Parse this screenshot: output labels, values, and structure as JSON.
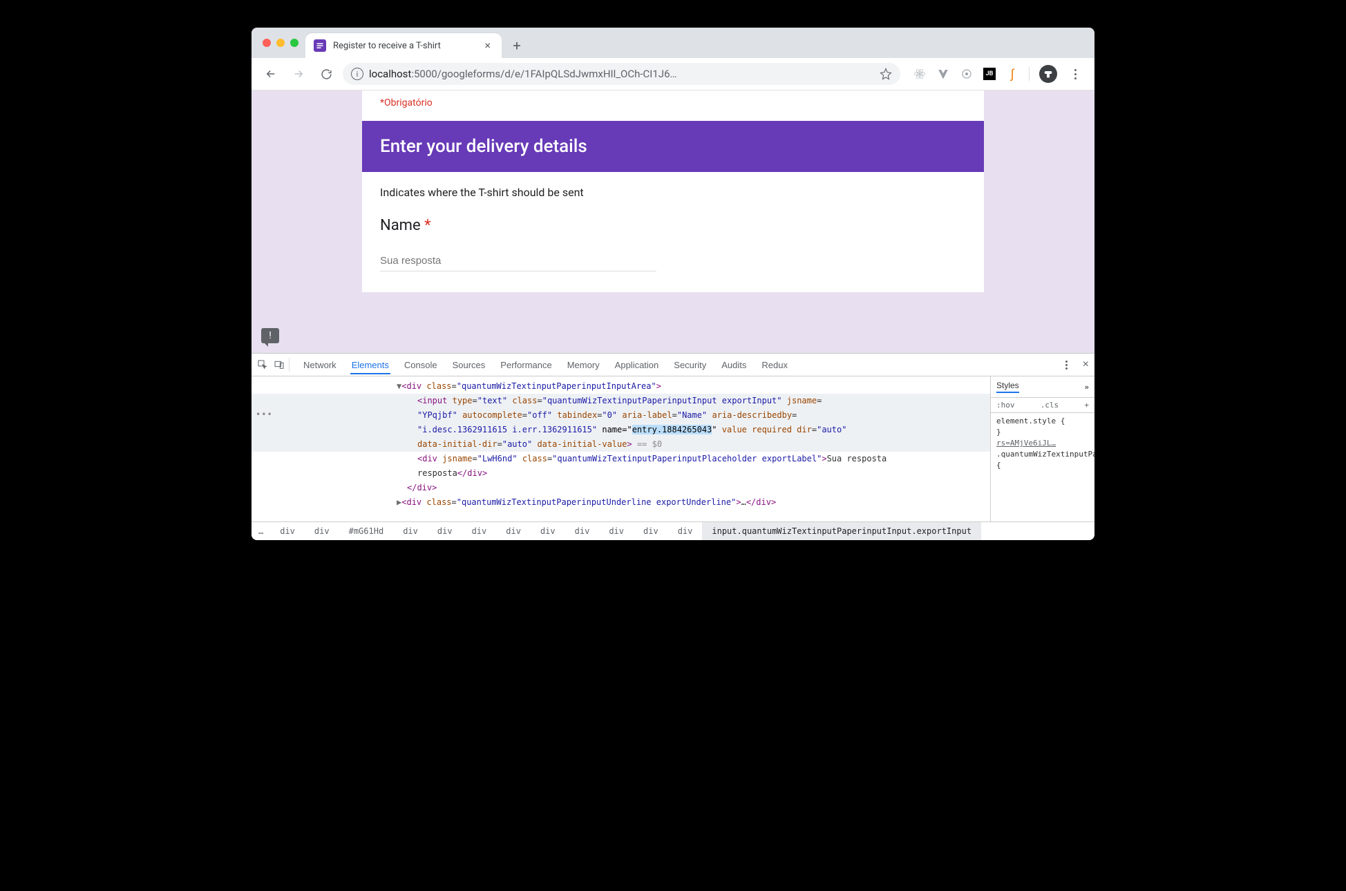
{
  "browser": {
    "tab_title": "Register to receive a T-shirt",
    "url_host": "localhost",
    "url_path": ":5000/googleforms/d/e/1FAIpQLSdJwmxHIl_OCh-CI1J6…"
  },
  "form": {
    "required_note": "*Obrigatório",
    "section_title": "Enter your delivery details",
    "section_desc": "Indicates where the T-shirt should be sent",
    "question_label": "Name",
    "required_mark": "*",
    "input_placeholder": "Sua resposta"
  },
  "devtools": {
    "tabs": {
      "network": "Network",
      "elements": "Elements",
      "console": "Console",
      "sources": "Sources",
      "performance": "Performance",
      "memory": "Memory",
      "application": "Application",
      "security": "Security",
      "audits": "Audits",
      "redux": "Redux"
    },
    "source": {
      "l1": "<div class=\"quantumWizTextinputPaperinputInputArea\">",
      "input_type": "text",
      "input_class": "quantumWizTextinputPaperinputInput exportInput",
      "input_jsname": "YPqjbf",
      "input_autocomplete": "off",
      "input_tabindex": "0",
      "input_arialabel": "Name",
      "input_ariadesc": "i.desc.1362911615 i.err.1362911615",
      "input_name_attr": "name=",
      "input_name_val": "entry.1884265043",
      "input_value_attr": "value",
      "input_required": "required",
      "input_dir": "auto",
      "input_didir": "auto",
      "input_divalue": "data-initial-value",
      "input_tail": " == $0",
      "placeholder_jsname": "LwH6nd",
      "placeholder_class": "quantumWizTextinputPaperinputPlaceholder exportLabel",
      "placeholder_text": "Sua resposta",
      "close_div": "</div>",
      "underline_class": "quantumWizTextinputPaperinputUnderline exportUnderline"
    },
    "styles": {
      "header_label": "Styles",
      "hov": ":hov",
      "cls": ".cls",
      "element_style": "element.style {",
      "brace": "}",
      "link": "rs=AMjVe6iJL…",
      "rule_sel": ".quantumWizTextinputPaperinputInput {"
    },
    "breadcrumb": {
      "dots": "…",
      "items": [
        "div",
        "div",
        "#mG61Hd",
        "div",
        "div",
        "div",
        "div",
        "div",
        "div",
        "div",
        "div",
        "div"
      ],
      "selected": "input.quantumWizTextinputPaperinputInput.exportInput"
    }
  }
}
